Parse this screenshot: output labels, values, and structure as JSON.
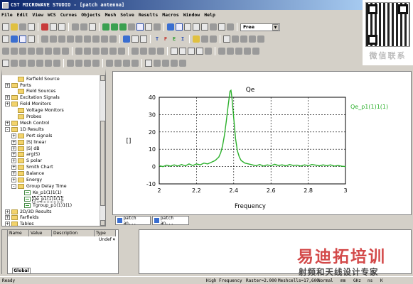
{
  "window": {
    "title": "CST MICROWAVE STUDIO - [patch antenna]"
  },
  "menu": [
    "File",
    "Edit",
    "View",
    "WCS",
    "Curves",
    "Objects",
    "Mesh",
    "Solve",
    "Results",
    "Macros",
    "Window",
    "Help"
  ],
  "toolbar": {
    "solver_mode": "Free",
    "badges": [
      "T",
      "F",
      "E",
      "I"
    ]
  },
  "qr": {
    "label": "微信联系"
  },
  "tree": {
    "items": [
      {
        "label": "Farfield Source",
        "indent": 1,
        "expander": "",
        "icon": "folder"
      },
      {
        "label": "Ports",
        "indent": 0,
        "expander": "+",
        "icon": "folder"
      },
      {
        "label": "Field Sources",
        "indent": 1,
        "expander": "",
        "icon": "folder"
      },
      {
        "label": "Excitation Signals",
        "indent": 0,
        "expander": "+",
        "icon": "folder"
      },
      {
        "label": "Field Monitors",
        "indent": 0,
        "expander": "+",
        "icon": "folder"
      },
      {
        "label": "Voltage Monitors",
        "indent": 1,
        "expander": "",
        "icon": "folder"
      },
      {
        "label": "Probes",
        "indent": 1,
        "expander": "",
        "icon": "folder"
      },
      {
        "label": "Mesh Control",
        "indent": 0,
        "expander": "+",
        "icon": "folder"
      },
      {
        "label": "1D Results",
        "indent": 0,
        "expander": "-",
        "icon": "folder"
      },
      {
        "label": "Port signals",
        "indent": 1,
        "expander": "+",
        "icon": "folder"
      },
      {
        "label": "|S| linear",
        "indent": 1,
        "expander": "+",
        "icon": "folder"
      },
      {
        "label": "|S| dB",
        "indent": 1,
        "expander": "+",
        "icon": "folder"
      },
      {
        "label": "arg(S)",
        "indent": 1,
        "expander": "+",
        "icon": "folder"
      },
      {
        "label": "S polar",
        "indent": 1,
        "expander": "+",
        "icon": "folder"
      },
      {
        "label": "Smith Chart",
        "indent": 1,
        "expander": "+",
        "icon": "folder"
      },
      {
        "label": "Balance",
        "indent": 1,
        "expander": "+",
        "icon": "folder"
      },
      {
        "label": "Energy",
        "indent": 1,
        "expander": "+",
        "icon": "folder"
      },
      {
        "label": "Group Delay Time",
        "indent": 1,
        "expander": "-",
        "icon": "folder"
      },
      {
        "label": "Ke_p1(1)1(1)",
        "indent": 2,
        "expander": "",
        "icon": "signal"
      },
      {
        "label": "Qe_p1(1)1(1)",
        "indent": 2,
        "expander": "",
        "icon": "signal",
        "selected": true
      },
      {
        "label": "Tgroup_p1(1)1(1)",
        "indent": 2,
        "expander": "",
        "icon": "signal"
      },
      {
        "label": "2D/3D Results",
        "indent": 0,
        "expander": "+",
        "icon": "folder"
      },
      {
        "label": "Farfields",
        "indent": 0,
        "expander": "+",
        "icon": "folder"
      },
      {
        "label": "Tables",
        "indent": 0,
        "expander": "+",
        "icon": "folder"
      }
    ]
  },
  "chart_data": {
    "type": "line",
    "title": "Qe",
    "xlabel": "Frequency",
    "ylabel": "[]",
    "xlim": [
      2,
      3
    ],
    "ylim": [
      -10,
      40
    ],
    "xticks": [
      "2",
      "2.2",
      "2.4",
      "2.6",
      "2.8",
      "3"
    ],
    "yticks": [
      "40",
      "30",
      "20",
      "10",
      "0",
      "-10"
    ],
    "grid": true,
    "legend_position": "top-right",
    "series": [
      {
        "name": "Qe_p1(1)1(1)",
        "color": "#2bb02b",
        "x": [
          2.0,
          2.02,
          2.04,
          2.06,
          2.08,
          2.1,
          2.12,
          2.14,
          2.16,
          2.18,
          2.2,
          2.22,
          2.24,
          2.26,
          2.28,
          2.3,
          2.32,
          2.33,
          2.34,
          2.35,
          2.36,
          2.37,
          2.38,
          2.385,
          2.39,
          2.4,
          2.41,
          2.42,
          2.43,
          2.44,
          2.46,
          2.48,
          2.5,
          2.52,
          2.54,
          2.56,
          2.58,
          2.6,
          2.62,
          2.64,
          2.66,
          2.68,
          2.7,
          2.72,
          2.74,
          2.76,
          2.78,
          2.8,
          2.82,
          2.84,
          2.86,
          2.88,
          2.9,
          2.92,
          2.94,
          2.96,
          2.98,
          3.0
        ],
        "values": [
          0.5,
          0.0,
          0.8,
          0.2,
          1.0,
          0.3,
          1.2,
          0.4,
          1.5,
          0.6,
          1.5,
          1.0,
          2.0,
          1.5,
          2.5,
          3.5,
          5.5,
          8.0,
          12.0,
          18.0,
          26.0,
          35.0,
          43.5,
          44.0,
          40.0,
          28.0,
          16.0,
          9.0,
          5.5,
          3.5,
          2.0,
          1.5,
          1.0,
          0.5,
          1.2,
          0.3,
          1.0,
          0.5,
          1.3,
          0.6,
          1.0,
          0.4,
          1.2,
          0.6,
          0.8,
          0.3,
          1.0,
          0.5,
          1.2,
          0.8,
          0.4,
          1.0,
          0.5,
          1.0,
          0.3,
          0.6,
          0.2,
          0.0
        ]
      }
    ]
  },
  "plot_tabs": [
    "patch an...",
    "patch an..."
  ],
  "param_table": {
    "columns": [
      "Name",
      "Value",
      "Description",
      "Type"
    ],
    "row_value": "Undef",
    "tab": "Global"
  },
  "watermark": {
    "main": "易迪拓培训",
    "sub": "射频和天线设计专家"
  },
  "status": {
    "left": "Ready",
    "mode": "High Frequency",
    "raster": "Raster=2.000",
    "meshcells": "Meshcells=17,600",
    "normal": "Normal",
    "units": [
      "mm",
      "GHz",
      "ns",
      "K"
    ]
  }
}
